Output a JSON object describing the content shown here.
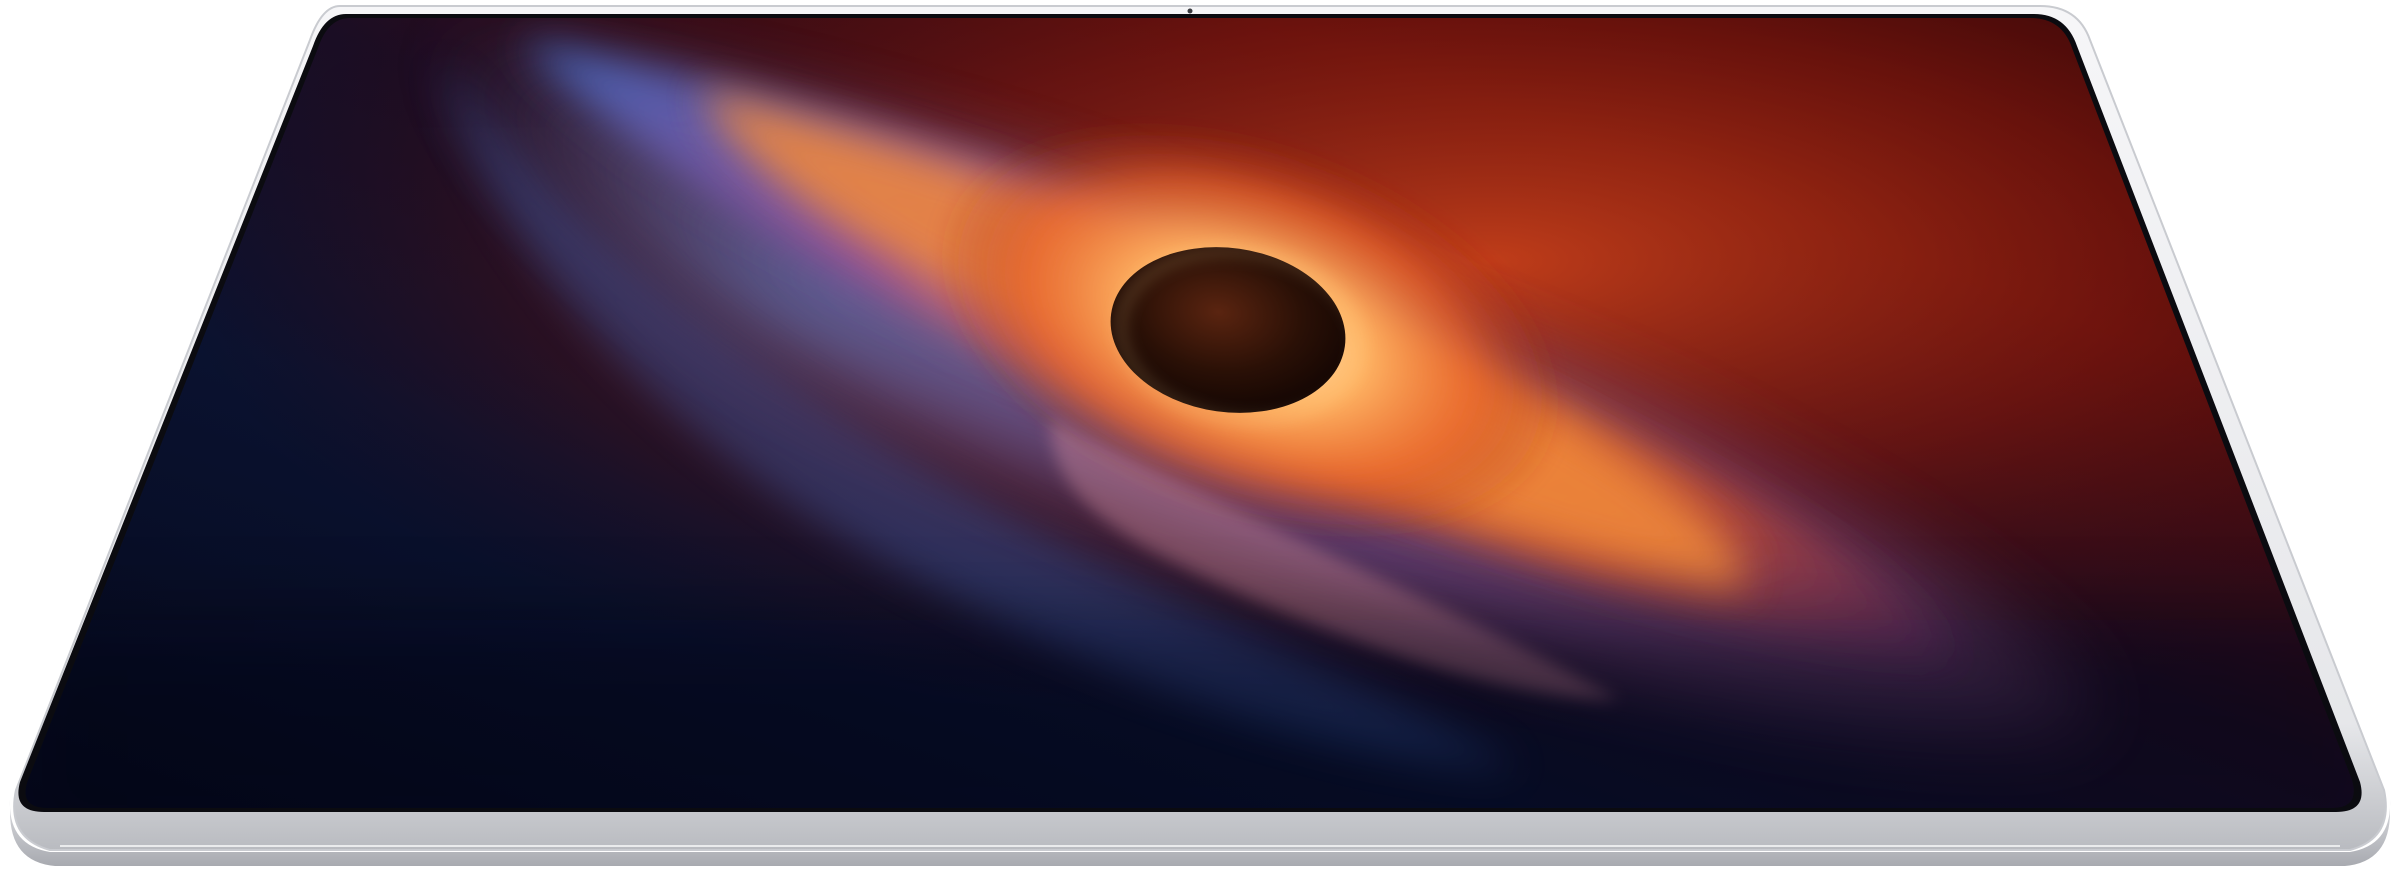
{
  "scene": {
    "subject": "tablet-device",
    "screen_content": "galaxy-wallpaper",
    "colors": {
      "page_background": "#ffffff",
      "bezel_highlight": "#f4f4f6",
      "bezel_shadow": "#b9bbc0",
      "screen_edge": "#0b0b10",
      "space_deep": "#070c1c",
      "space_red": "#3a0608",
      "galaxy_orange": "#f07a2c",
      "galaxy_core": "#ffd9a0",
      "galaxy_blue": "#3f6bc4",
      "galaxy_purple": "#9a4e9a",
      "black_hole": "#2a1208"
    }
  }
}
